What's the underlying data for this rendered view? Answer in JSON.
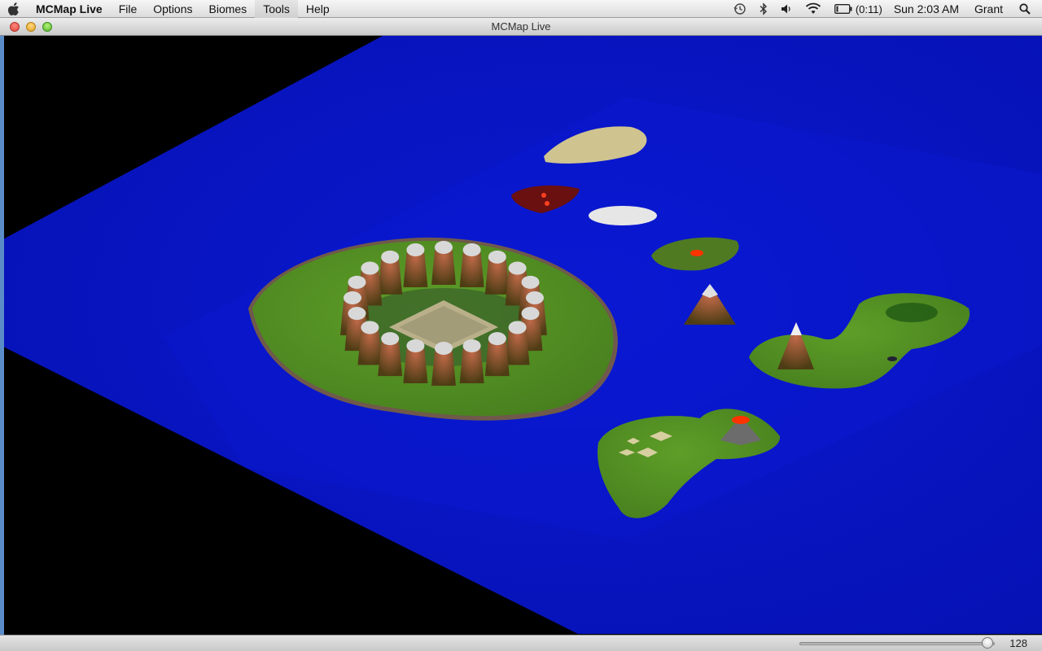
{
  "menubar": {
    "app_name": "MCMap Live",
    "menus": [
      "File",
      "Options",
      "Biomes",
      "Tools",
      "Help"
    ],
    "active_menu": "Tools",
    "status": {
      "battery": "(0:11)",
      "clock": "Sun 2:03 AM",
      "user": "Grant"
    },
    "icons": [
      "apple-icon",
      "time-machine-icon",
      "bluetooth-icon",
      "volume-icon",
      "wifi-icon",
      "battery-icon",
      "spotlight-icon"
    ]
  },
  "window": {
    "title": "MCMap Live"
  },
  "map": {
    "colors": {
      "water": "#0a14c8",
      "grass": "#5a9a2a",
      "sand": "#c9c08a",
      "nether": "#6a1010",
      "snow": "#e8e8e8",
      "lava": "#ff3300",
      "void": "#000000"
    }
  },
  "statusbar": {
    "zoom_value": "128",
    "zoom_fraction": 0.99
  }
}
